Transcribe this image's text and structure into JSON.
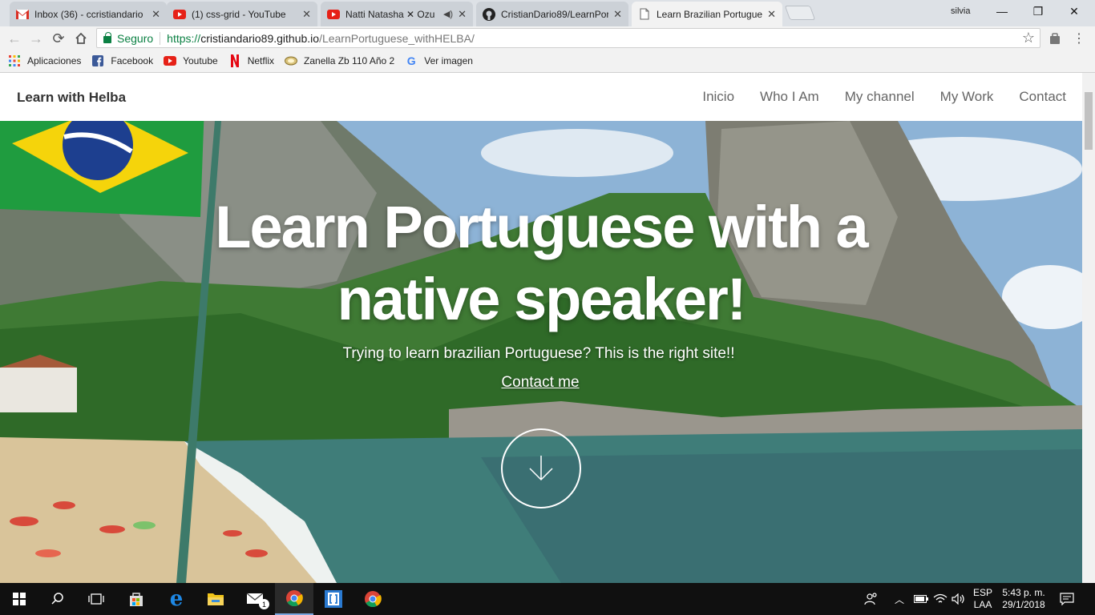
{
  "browser": {
    "tabs": [
      {
        "title": "Inbox (36) - ccristiandario",
        "icon": "gmail-icon",
        "active": false
      },
      {
        "title": "(1) css-grid - YouTube",
        "icon": "youtube-icon",
        "active": false
      },
      {
        "title": "Natti Natasha ✕ Ozu",
        "icon": "youtube-icon",
        "active": false
      },
      {
        "title": "CristianDario89/LearnPor",
        "icon": "github-icon",
        "active": false
      },
      {
        "title": "Learn Brazilian Portugues",
        "icon": "page-icon",
        "active": true
      }
    ],
    "profile_name": "silvia",
    "security_label": "Seguro",
    "url": {
      "protocol": "https://",
      "host": "cristiandario89.github.io",
      "path": "/LearnPortuguese_withHELBA/"
    },
    "bookmarks": [
      {
        "label": "Aplicaciones",
        "icon": "apps-grid-icon"
      },
      {
        "label": "Facebook",
        "icon": "facebook-icon"
      },
      {
        "label": "Youtube",
        "icon": "youtube-icon"
      },
      {
        "label": "Netflix",
        "icon": "netflix-icon"
      },
      {
        "label": "Zanella Zb 110 Año 2",
        "icon": "bookmark-icon"
      },
      {
        "label": "Ver imagen",
        "icon": "google-icon"
      }
    ]
  },
  "site": {
    "brand": "Learn with Helba",
    "nav": [
      "Inicio",
      "Who I Am",
      "My channel",
      "My Work",
      "Contact"
    ],
    "hero": {
      "title_line1": "Learn Portuguese with a",
      "title_line2": "native speaker!",
      "subtitle": "Trying to learn brazilian Portuguese? This is the right site!!",
      "cta": "Contact me"
    }
  },
  "taskbar": {
    "language_line1": "ESP",
    "language_line2": "LAA",
    "time": "5:43 p. m.",
    "date": "29/1/2018",
    "mail_badge": "1"
  },
  "colors": {
    "secure_green": "#0b8043",
    "taskbar_bg": "#101010",
    "brazil_green": "#1f9c3f",
    "brazil_yellow": "#f5d40b",
    "brazil_blue": "#1d3f8f"
  }
}
